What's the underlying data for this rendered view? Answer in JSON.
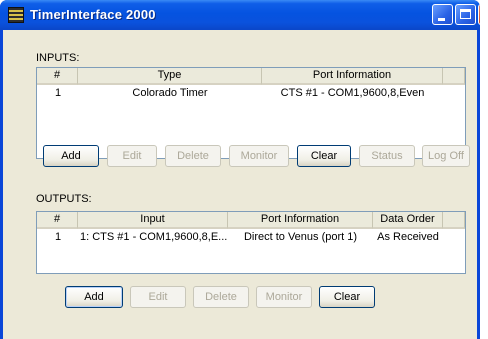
{
  "window": {
    "title": "TimerInterface 2000"
  },
  "inputs": {
    "label": "INPUTS:",
    "columns": [
      "#",
      "Type",
      "Port Information"
    ],
    "rows": [
      {
        "num": "1",
        "type": "Colorado Timer",
        "port": "CTS #1 - COM1,9600,8,Even"
      }
    ],
    "buttons": {
      "add": "Add",
      "edit": "Edit",
      "delete": "Delete",
      "monitor": "Monitor",
      "clear": "Clear",
      "status": "Status",
      "logoff": "Log Off"
    }
  },
  "outputs": {
    "label": "OUTPUTS:",
    "columns": [
      "#",
      "Input",
      "Port Information",
      "Data Order"
    ],
    "rows": [
      {
        "num": "1",
        "input": "1: CTS #1 - COM1,9600,8,E...",
        "port": "Direct to Venus (port 1)",
        "order": "As Received"
      }
    ],
    "buttons": {
      "add": "Add",
      "edit": "Edit",
      "delete": "Delete",
      "monitor": "Monitor",
      "clear": "Clear"
    }
  }
}
